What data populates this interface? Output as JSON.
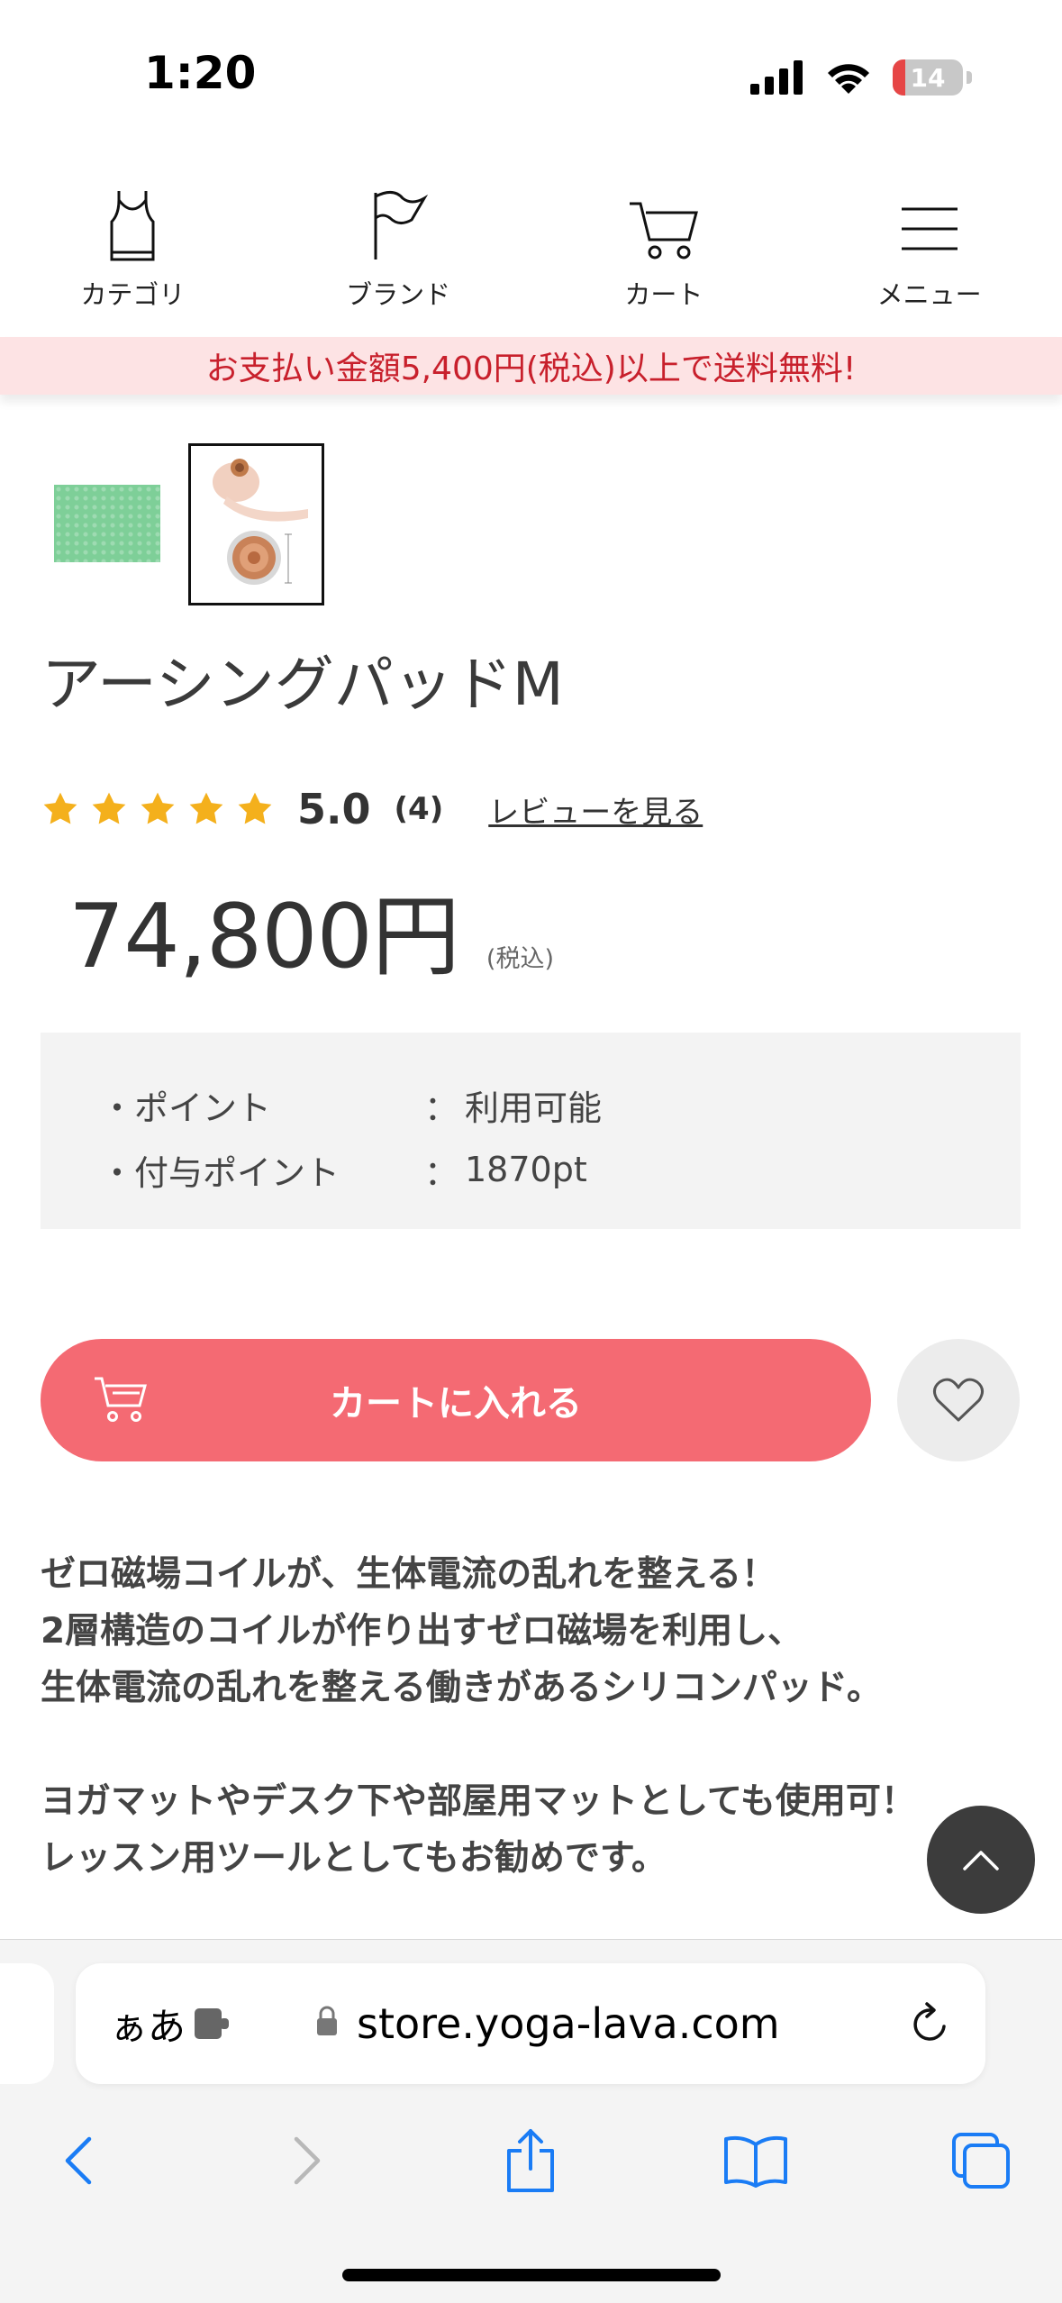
{
  "status_bar": {
    "time": "1:20",
    "battery": "14"
  },
  "nav": {
    "items": [
      {
        "label": "カテゴリ",
        "icon": "tank-top-icon"
      },
      {
        "label": "ブランド",
        "icon": "flag-icon"
      },
      {
        "label": "カート",
        "icon": "cart-icon"
      },
      {
        "label": "メニュー",
        "icon": "menu-icon"
      }
    ]
  },
  "banner": {
    "text": "お支払い金額5,400円(税込)以上で送料無料!"
  },
  "product": {
    "title": "アーシングパッドM",
    "rating": "5.0",
    "review_count": "(4)",
    "review_link": "レビューを見る",
    "stars": 5,
    "price": "74,800円",
    "tax_note": "(税込)"
  },
  "points": {
    "rows": [
      {
        "label": "・ポイント",
        "colon": "：",
        "value": "利用可能"
      },
      {
        "label": "・付与ポイント",
        "colon": "：",
        "value": "1870pt"
      }
    ]
  },
  "actions": {
    "cart_label": "カートに入れる"
  },
  "description": {
    "lines_a": [
      "ゼロ磁場コイルが、生体電流の乱れを整える！",
      "2層構造のコイルが作り出すゼロ磁場を利用し、",
      "生体電流の乱れを整える働きがあるシリコンパッド。"
    ],
    "lines_b": [
      "ヨガマットやデスク下や部屋用マットとしても使用可！",
      "レッスン用ツールとしてもお勧めです。"
    ]
  },
  "browser": {
    "aa": "ぁあ",
    "url": "store.yoga-lava.com"
  },
  "colors": {
    "accent": "#f46a73",
    "banner_text": "#c8202c",
    "banner_bg": "#fde3e4",
    "star": "#f4b01c",
    "ios_blue": "#1a7cf5"
  }
}
